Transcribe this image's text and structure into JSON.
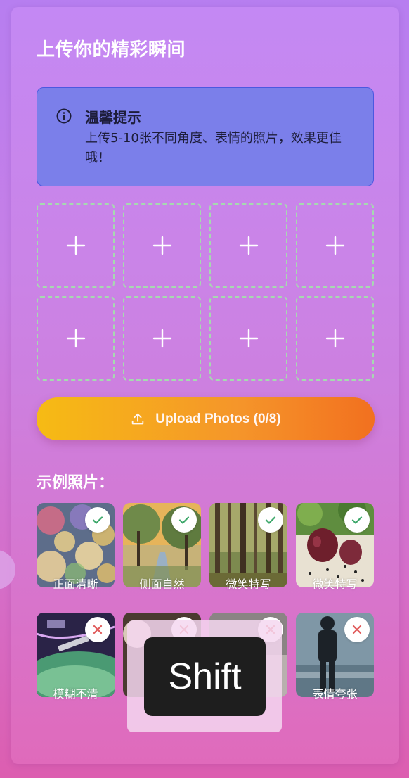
{
  "page": {
    "title": "上传你的精彩瞬间"
  },
  "tip": {
    "icon": "info-icon",
    "title": "温馨提示",
    "body": "上传5-10张不同角度、表情的照片，效果更佳哦！"
  },
  "upload_slots": {
    "count": 8,
    "icon": "plus-icon"
  },
  "upload_button": {
    "label": "Upload Photos (0/8)",
    "icon": "upload-icon",
    "uploaded": 0,
    "max": 8
  },
  "examples": {
    "title": "示例照片：",
    "items": [
      {
        "caption": "正面清晰",
        "status": "good",
        "scene": "bokeh-lights"
      },
      {
        "caption": "侧面自然",
        "status": "good",
        "scene": "autumn-road"
      },
      {
        "caption": "微笑特写",
        "status": "good",
        "scene": "forest-trees"
      },
      {
        "caption": "微笑特写",
        "status": "good",
        "scene": "onion-peppercorns"
      },
      {
        "caption": "模糊不清",
        "status": "bad",
        "scene": "space-station"
      },
      {
        "caption": "",
        "status": "bad",
        "scene": "hidden"
      },
      {
        "caption": "",
        "status": "bad",
        "scene": "hidden"
      },
      {
        "caption": "表情夸张",
        "status": "bad",
        "scene": "person-silhouette"
      }
    ]
  },
  "key_overlay": {
    "label": "Shift"
  },
  "colors": {
    "accent_start": "#f6bb14",
    "accent_end": "#f2701f",
    "tip_background": "#7b7fea",
    "good": "#3ea86b",
    "bad": "#e05a5a"
  }
}
